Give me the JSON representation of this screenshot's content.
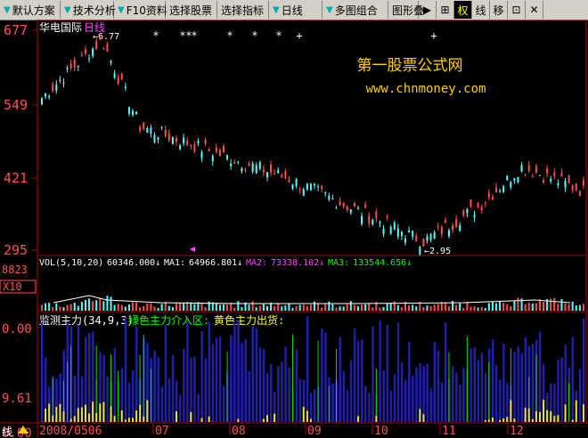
{
  "toolbar": {
    "items": [
      {
        "label": "默认方案",
        "arrow": "▼"
      },
      {
        "label": "技术分析",
        "arrow": "▼"
      },
      {
        "label": "F10资料",
        "arrow": "▼"
      },
      {
        "label": "选择股票",
        "arrow": ""
      },
      {
        "label": "选择指标",
        "arrow": ""
      },
      {
        "label": "日线",
        "arrow": "▼"
      },
      {
        "label": "多图组合",
        "arrow": "▼"
      },
      {
        "label": "图形叠",
        "arrow": ""
      }
    ],
    "icons": [
      {
        "label": "▶",
        "name": "play-icon",
        "active": false
      },
      {
        "label": "⊞",
        "name": "crosshair-icon",
        "active": false
      },
      {
        "label": "权",
        "name": "adjust-rights-button",
        "active": true
      },
      {
        "label": "线",
        "name": "line-button",
        "active": false
      },
      {
        "label": "移",
        "name": "move-button",
        "active": false
      },
      {
        "label": "⊡",
        "name": "window-icon",
        "active": false
      },
      {
        "label": "✕",
        "name": "close-icon",
        "active": false
      }
    ]
  },
  "price_panel": {
    "stock_name": "华电国际",
    "period": "日线",
    "y_ticks": [
      "677",
      "549",
      "421",
      "295"
    ],
    "high_label": "6.77",
    "low_label": "2.95",
    "watermark_title": "第一股票公式网",
    "watermark_url": "www.chnmoney.com"
  },
  "vol_panel": {
    "label": "VOL(5,10,20)",
    "value": "60346.000",
    "ma1_label": "MA1:",
    "ma1": "64966.801",
    "ma2_label": "MA2:",
    "ma2": "73338.102",
    "ma3_label": "MA3:",
    "ma3": "133544.656",
    "y_ticks": [
      "8823",
      "X10"
    ],
    "arrow": "↓"
  },
  "indicator_panel": {
    "title": "监测主力(34,9,3)",
    "green_label": "绿色主力介入区:",
    "yellow_label": "黄色主力出货:",
    "y_ticks": [
      "0.00",
      "9.61",
      "0.00"
    ]
  },
  "x_axis": {
    "prefix": "线",
    "labels": [
      "2008/0506",
      "07",
      "08",
      "09",
      "10",
      "11",
      "12"
    ]
  },
  "colors": {
    "up": "#ff5050",
    "down": "#54ffff",
    "axis": "#b00000",
    "blue": "#2020b0",
    "green": "#00e000",
    "yellow": "#e8e040",
    "pink": "#ff40ff"
  }
}
